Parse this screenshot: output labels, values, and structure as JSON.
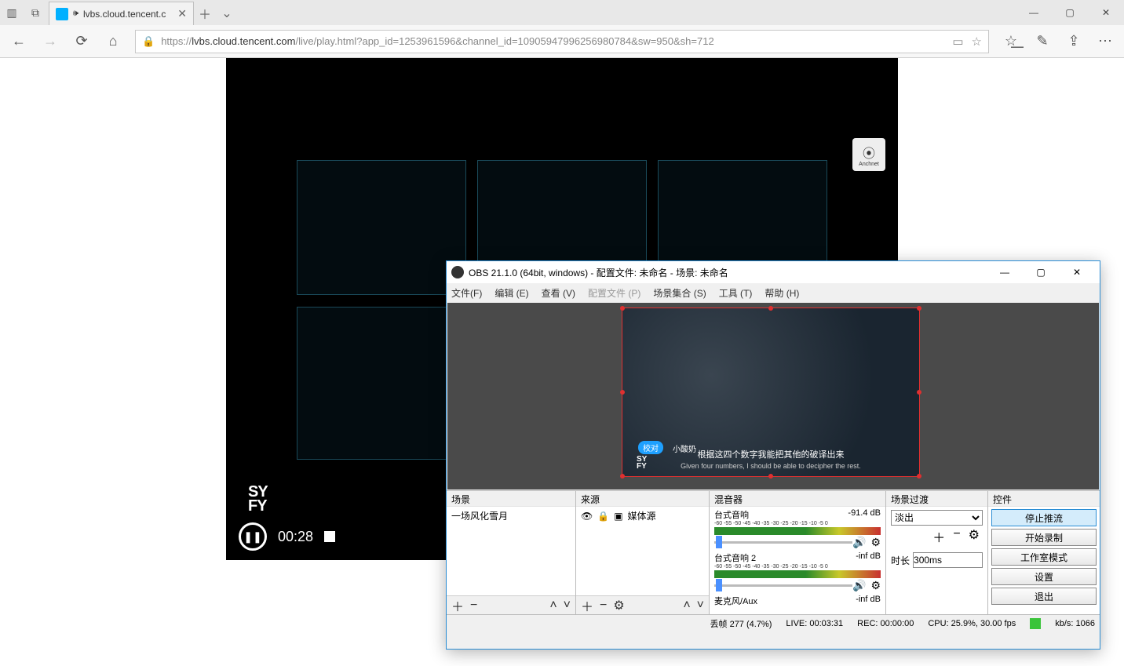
{
  "edge": {
    "tab_title": "lvbs.cloud.tencent.c",
    "url_host": "lvbs.cloud.tencent.com",
    "url_path": "/live/play.html?app_id=1253961596&channel_id=10905947996256980784&sw=950&sh=712",
    "url_prefix": "https://"
  },
  "video": {
    "time": "00:28",
    "logo": "SY\nFY",
    "watermark": "Anchnet"
  },
  "obs": {
    "title": "OBS 21.1.0 (64bit, windows) - 配置文件: 未命名 - 场景: 未命名",
    "menu": {
      "file": "文件(F)",
      "edit": "编辑 (E)",
      "view": "查看 (V)",
      "profile": "配置文件 (P)",
      "scenecol": "场景集合 (S)",
      "tools": "工具 (T)",
      "help": "帮助 (H)"
    },
    "preview": {
      "pill": "校对",
      "pill_name": "小酸奶",
      "sub_cn": "根据这四个数字我能把其他的破译出来",
      "sub_en": "Given four numbers, I should be able to decipher the rest.",
      "logo": "SY\nFY"
    },
    "docks": {
      "scenes": {
        "title": "场景",
        "items": [
          "一场风化雪月"
        ]
      },
      "sources": {
        "title": "来源",
        "items": [
          "媒体源"
        ]
      },
      "mixer": {
        "title": "混音器",
        "channels": [
          {
            "name": "台式音响",
            "db": "-91.4 dB"
          },
          {
            "name": "台式音响 2",
            "db": "-inf dB"
          },
          {
            "name": "麦克风/Aux",
            "db": "-inf dB"
          }
        ],
        "ticks": "-60  -55  -50  -45  -40  -35  -30  -25  -20  -15  -10  -5  0"
      },
      "transitions": {
        "title": "场景过渡",
        "selected": "淡出",
        "duration_label": "时长",
        "duration_value": "300ms"
      },
      "controls": {
        "title": "控件",
        "buttons": {
          "stop_stream": "停止推流",
          "start_rec": "开始录制",
          "studio": "工作室模式",
          "settings": "设置",
          "exit": "退出"
        }
      }
    },
    "status": {
      "dropped": "丢帧 277 (4.7%)",
      "live": "LIVE: 00:03:31",
      "rec": "REC: 00:00:00",
      "cpu": "CPU: 25.9%, 30.00 fps",
      "bitrate": "kb/s: 1066"
    }
  }
}
